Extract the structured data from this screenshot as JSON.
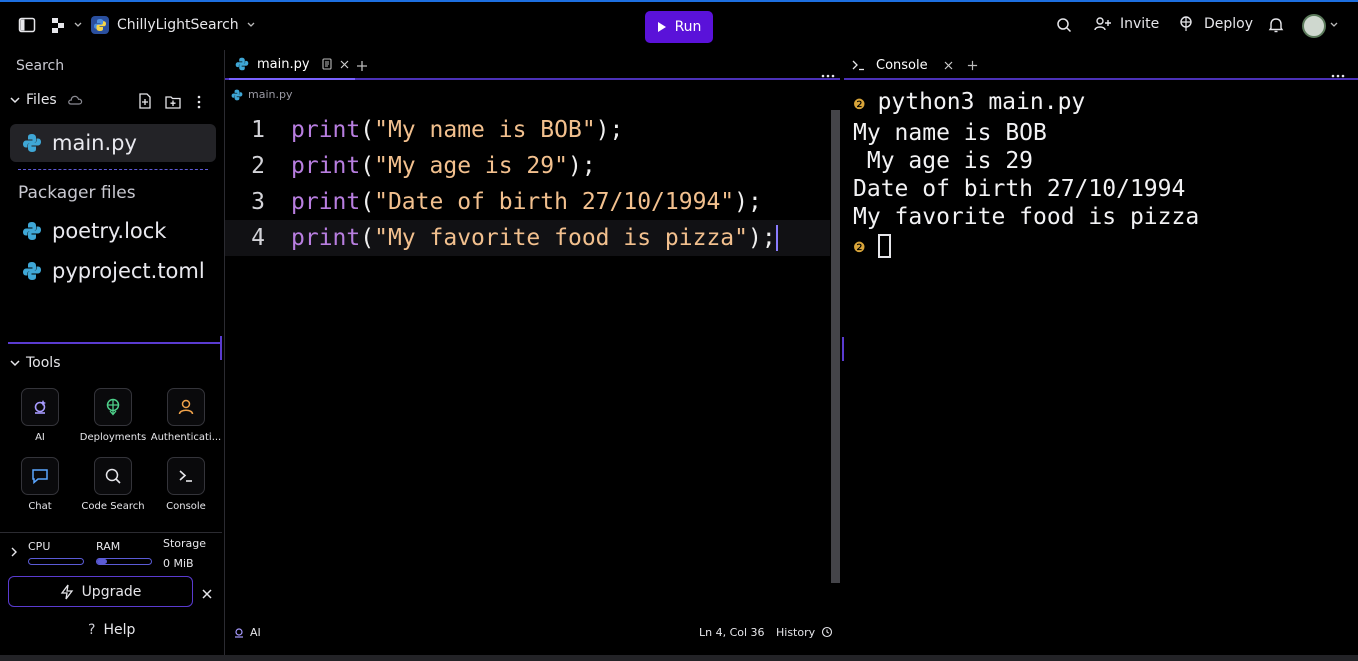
{
  "topbar": {
    "project_name": "ChillyLightSearch",
    "run_label": "Run",
    "invite_label": "Invite",
    "deploy_label": "Deploy"
  },
  "sidebar": {
    "search_label": "Search",
    "files_label": "Files",
    "files": [
      {
        "name": "main.py"
      }
    ],
    "packager_label": "Packager files",
    "packager_files": [
      {
        "name": "poetry.lock"
      },
      {
        "name": "pyproject.toml"
      }
    ],
    "tools_label": "Tools",
    "tools": [
      {
        "label": "AI"
      },
      {
        "label": "Deployments"
      },
      {
        "label": "Authenticati..."
      },
      {
        "label": "Chat"
      },
      {
        "label": "Code Search"
      },
      {
        "label": "Console"
      }
    ],
    "resources": {
      "cpu_label": "CPU",
      "ram_label": "RAM",
      "storage_label": "Storage",
      "storage_value": "0 MiB"
    },
    "upgrade_label": "Upgrade",
    "help_label": "Help"
  },
  "editor": {
    "tab_label": "main.py",
    "breadcrumb": "main.py",
    "lines": [
      {
        "num": "1",
        "fn": "print",
        "open": "(",
        "str": "\"My name is BOB\"",
        "close": ");"
      },
      {
        "num": "2",
        "fn": "print",
        "open": "(",
        "str": "\"My age is 29\"",
        "close": ");"
      },
      {
        "num": "3",
        "fn": "print",
        "open": "(",
        "str": "\"Date of birth 27/10/1994\"",
        "close": ");"
      },
      {
        "num": "4",
        "fn": "print",
        "open": "(",
        "str": "\"My favorite food is pizza\"",
        "close": ");"
      }
    ],
    "status": {
      "ai_label": "AI",
      "position": "Ln 4, Col 36",
      "history_label": "History"
    }
  },
  "console": {
    "tab_label": "Console",
    "command": "python3 main.py",
    "output": [
      "My name is BOB",
      " My age is 29",
      "Date of birth 27/10/1994",
      "My favorite food is pizza"
    ]
  },
  "colors": {
    "accent": "#5a12d9",
    "divider": "#4b31b8",
    "keyword": "#b87ee0",
    "string": "#f2c08e",
    "prompt": "#d9a53a"
  }
}
